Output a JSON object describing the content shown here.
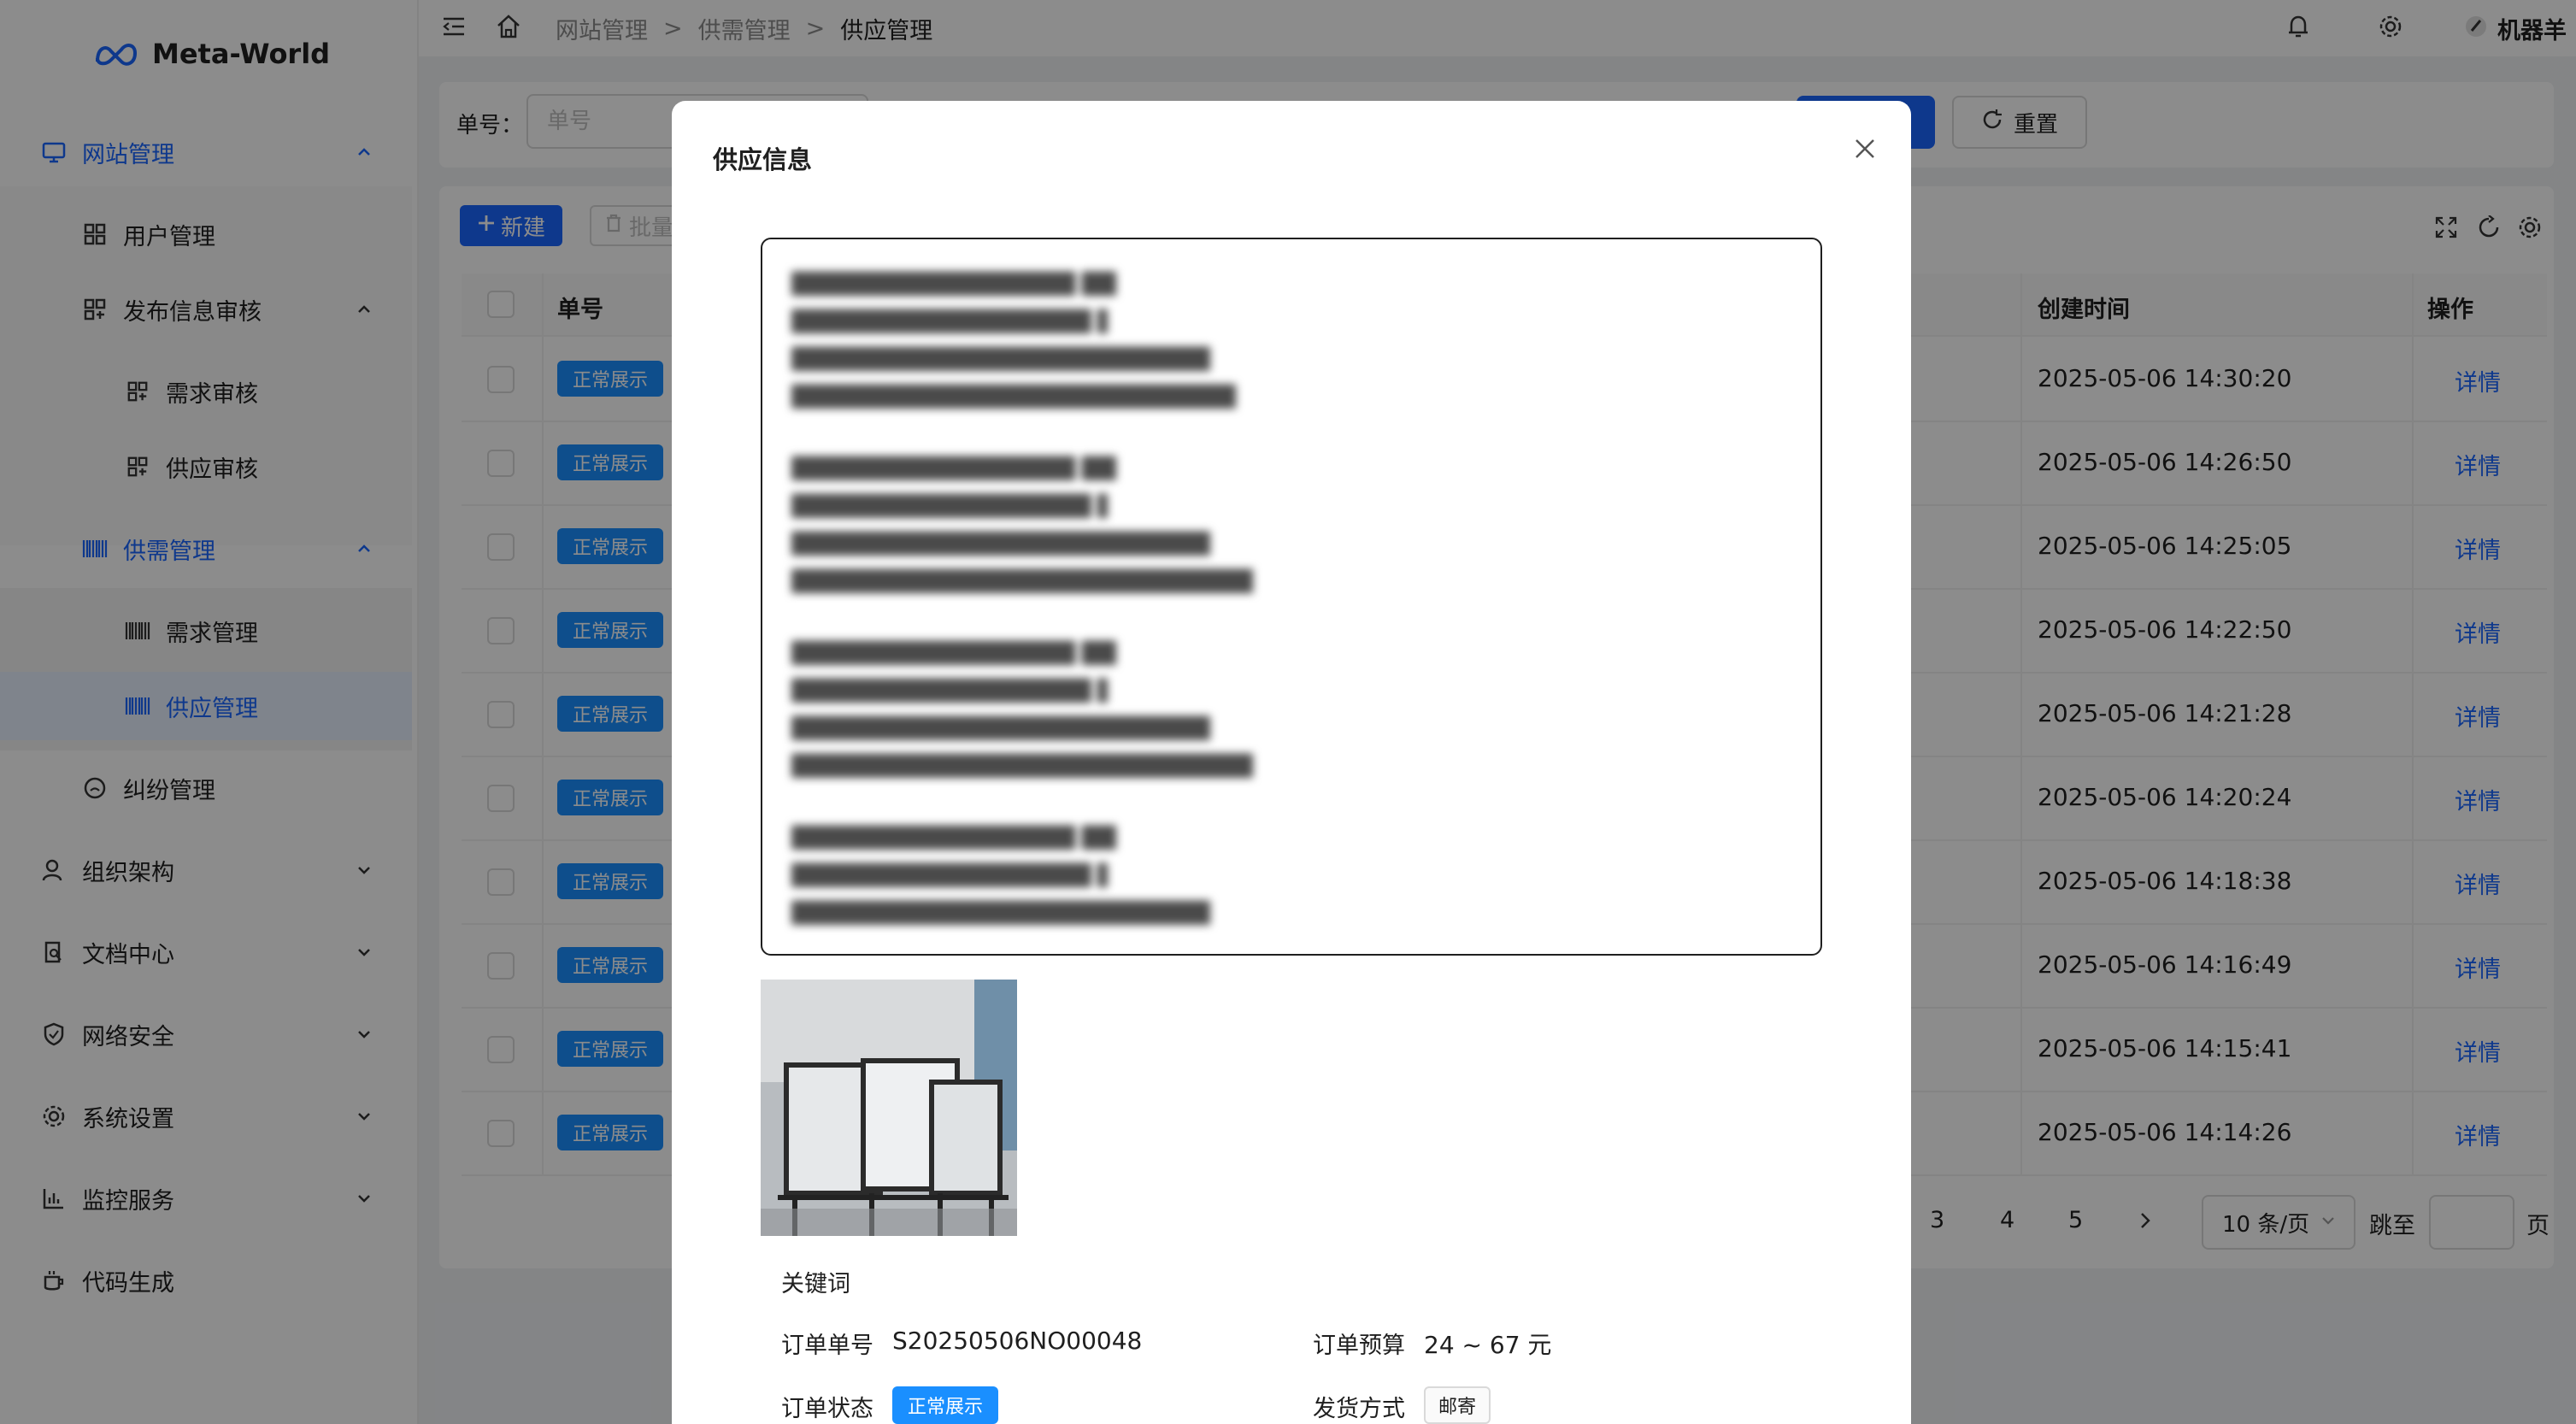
{
  "app": {
    "name": "Meta-World"
  },
  "sidebar": {
    "items": [
      {
        "label": "网站管理",
        "icon": "monitor-icon"
      },
      {
        "label": "用户管理",
        "icon": "grid-icon"
      },
      {
        "label": "发布信息审核",
        "icon": "apps-icon"
      },
      {
        "label": "需求审核",
        "icon": "apps-icon"
      },
      {
        "label": "供应审核",
        "icon": "apps-icon"
      },
      {
        "label": "供需管理",
        "icon": "barcode-icon"
      },
      {
        "label": "需求管理",
        "icon": "barcode-icon"
      },
      {
        "label": "供应管理",
        "icon": "barcode-icon"
      },
      {
        "label": "纠纷管理",
        "icon": "smile-icon"
      },
      {
        "label": "组织架构",
        "icon": "user-icon"
      },
      {
        "label": "文档中心",
        "icon": "document-search-icon"
      },
      {
        "label": "网络安全",
        "icon": "shield-icon"
      },
      {
        "label": "系统设置",
        "icon": "gear-icon"
      },
      {
        "label": "监控服务",
        "icon": "bar-chart-icon"
      },
      {
        "label": "代码生成",
        "icon": "coffee-icon"
      }
    ]
  },
  "header": {
    "breadcrumb": [
      "网站管理",
      ">",
      "供需管理",
      ">",
      "供应管理"
    ],
    "user": "机器羊"
  },
  "search": {
    "label": "单号：",
    "placeholder": "单号",
    "reset_label": "重置"
  },
  "toolbar": {
    "new_label": "新建",
    "batch_label": "批量"
  },
  "table": {
    "columns": {
      "order": "单号",
      "created": "创建时间",
      "action": "操作"
    },
    "rows": [
      {
        "status": "正常展示",
        "created": "2025-05-06 14:30:20",
        "action": "详情"
      },
      {
        "status": "正常展示",
        "created": "2025-05-06 14:26:50",
        "action": "详情"
      },
      {
        "status": "正常展示",
        "created": "2025-05-06 14:25:05",
        "action": "详情"
      },
      {
        "status": "正常展示",
        "created": "2025-05-06 14:22:50",
        "action": "详情"
      },
      {
        "status": "正常展示",
        "created": "2025-05-06 14:21:28",
        "action": "详情"
      },
      {
        "status": "正常展示",
        "created": "2025-05-06 14:20:24",
        "action": "详情"
      },
      {
        "status": "正常展示",
        "created": "2025-05-06 14:18:38",
        "action": "详情"
      },
      {
        "status": "正常展示",
        "created": "2025-05-06 14:16:49",
        "action": "详情"
      },
      {
        "status": "正常展示",
        "created": "2025-05-06 14:15:41",
        "action": "详情"
      },
      {
        "status": "正常展示",
        "created": "2025-05-06 14:14:26",
        "action": "详情"
      }
    ]
  },
  "pagination": {
    "pages": [
      "3",
      "4",
      "5"
    ],
    "page_size": "10 条/页",
    "jump_label": "跳至",
    "suffix": "页"
  },
  "modal": {
    "title": "供应信息",
    "keywords_label": "关键词",
    "order_no_label": "订单单号",
    "order_no": "S20250506NO00048",
    "budget_label": "订单预算",
    "budget": "24 ~ 67 元",
    "status_label": "订单状态",
    "status": "正常展示",
    "shipping_label": "发货方式",
    "shipping": "邮寄"
  },
  "colors": {
    "primary": "#1a66ff",
    "tag": "#1a8fff",
    "mask": "rgba(0,0,0,0.45)"
  }
}
